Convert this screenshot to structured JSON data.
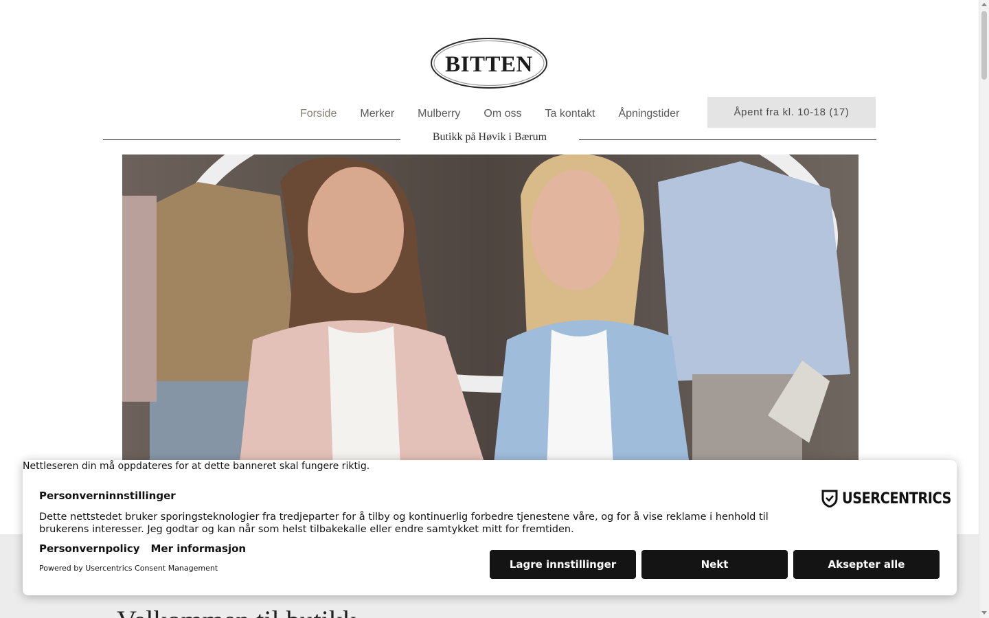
{
  "brand": {
    "logo_text": "BITTEN"
  },
  "nav": {
    "items": [
      {
        "label": "Forside",
        "active": true
      },
      {
        "label": "Merker",
        "active": false
      },
      {
        "label": "Mulberry",
        "active": false
      },
      {
        "label": "Om oss",
        "active": false
      },
      {
        "label": "Ta kontakt",
        "active": false
      },
      {
        "label": "Åpningstider",
        "active": false
      }
    ],
    "hours_label": "Åpent fra kl. 10-18 (17)"
  },
  "header": {
    "tagline": "Butikk på Høvik i Bærum"
  },
  "main": {
    "welcome_heading": "Velkommen til butikk"
  },
  "consent": {
    "browser_warning": "Nettleseren din må oppdateres for at dette banneret skal fungere riktig.",
    "title": "Personverninnstillinger",
    "body": "Dette nettstedet bruker sporingsteknologier fra tredjeparter for å tilby og kontinuerlig forbedre tjenestene våre, og for å vise reklame i henhold til brukerens interesser. Jeg godtar og kan når som helst tilbakekalle eller endre samtykket mitt for fremtiden.",
    "privacy_link": "Personvernpolicy",
    "more_info_link": "Mer informasjon",
    "powered_by": "Powered by Usercentrics Consent Management",
    "brand_label": "USERCENTRICS",
    "save_label": "Lagre innstillinger",
    "deny_label": "Nekt",
    "accept_label": "Aksepter alle"
  },
  "colors": {
    "nav_active": "#8a7c72",
    "nav_default": "#5a5a5a",
    "hours_bg": "#e4e4e4",
    "consent_button_bg": "#141414",
    "grey_band": "#ececec"
  },
  "icons": {
    "usercentrics": "shield-check-icon",
    "scroll_up": "triangle-up-icon",
    "scroll_down": "triangle-down-icon"
  }
}
